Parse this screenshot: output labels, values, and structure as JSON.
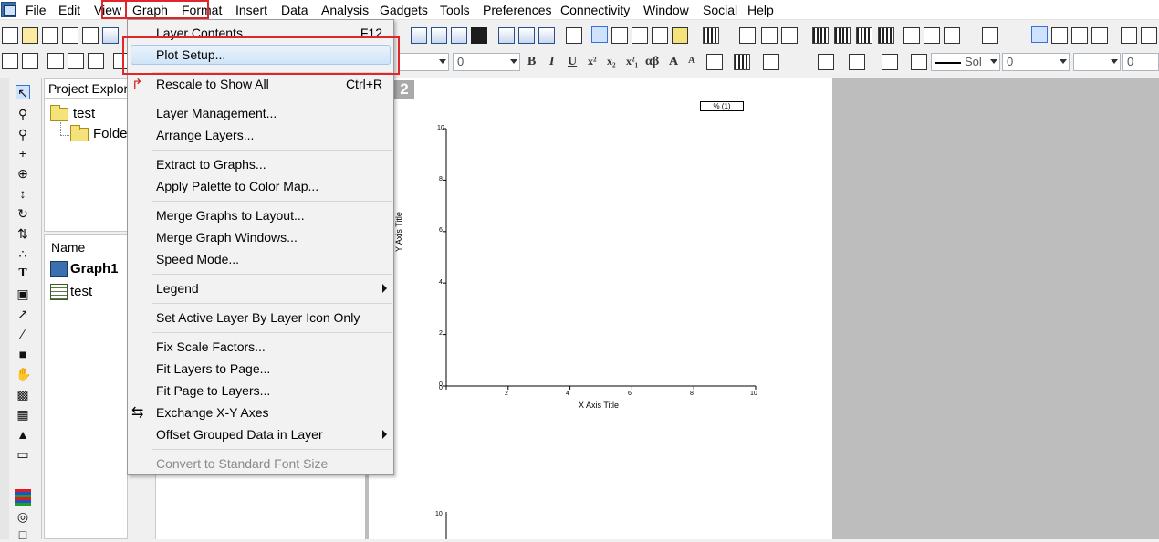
{
  "menubar": {
    "items": [
      "File",
      "Edit",
      "View",
      "Graph",
      "Format",
      "Insert",
      "Data",
      "Analysis",
      "Gadgets",
      "Tools",
      "Preferences",
      "Connectivity",
      "Window",
      "Social",
      "Help"
    ]
  },
  "toolbar": {
    "font_size_value": "0",
    "second_size_value": "0",
    "third_value": "0",
    "line_style_label": "Sol",
    "format_buttons": [
      "B",
      "I",
      "U",
      "x²",
      "x₂",
      "x²₁",
      "αβ",
      "A",
      "A"
    ]
  },
  "project_explorer": {
    "title": "Project Explore",
    "tree": [
      {
        "label": "test"
      },
      {
        "label": "Folde"
      }
    ],
    "list_header": "Name",
    "list_items": [
      {
        "label": "Graph1",
        "bold": true
      },
      {
        "label": "test",
        "bold": false
      }
    ]
  },
  "graph": {
    "layer_tab": "2",
    "legend_text": "% (1)",
    "x_axis_title": "X Axis Title",
    "y_axis_title": "Y Axis Title",
    "x_ticks": [
      "0",
      "2",
      "4",
      "6",
      "8",
      "10"
    ],
    "y_ticks": [
      "0",
      "2",
      "4",
      "6",
      "8",
      "10"
    ],
    "lower_y_tick": "10"
  },
  "graph_menu": {
    "items": [
      {
        "label": "Layer Contents...",
        "shortcut": "F12"
      },
      {
        "label": "Plot Setup...",
        "shortcut": "",
        "highlighted": true
      },
      {
        "label": "Rescale to Show All",
        "shortcut": "Ctrl+R"
      },
      {
        "label": "Layer Management...",
        "shortcut": ""
      },
      {
        "label": "Arrange Layers...",
        "shortcut": ""
      },
      {
        "label": "Extract to Graphs...",
        "shortcut": ""
      },
      {
        "label": "Apply Palette to Color Map...",
        "shortcut": ""
      },
      {
        "label": "Merge Graphs to Layout...",
        "shortcut": ""
      },
      {
        "label": "Merge Graph Windows...",
        "shortcut": ""
      },
      {
        "label": "Speed Mode...",
        "shortcut": ""
      },
      {
        "label": "Legend",
        "shortcut": "",
        "submenu": true
      },
      {
        "label": "Set Active Layer By Layer Icon Only",
        "shortcut": ""
      },
      {
        "label": "Fix Scale Factors...",
        "shortcut": ""
      },
      {
        "label": "Fit Layers to Page...",
        "shortcut": ""
      },
      {
        "label": "Fit Page to Layers...",
        "shortcut": ""
      },
      {
        "label": "Exchange X-Y Axes",
        "shortcut": ""
      },
      {
        "label": "Offset Grouped Data in Layer",
        "shortcut": "",
        "submenu": true
      },
      {
        "label": "Convert to Standard Font Size",
        "shortcut": "",
        "disabled": true
      }
    ]
  },
  "colors": {
    "highlight_border": "#e0252b",
    "menu_hover": "#cfe4f8"
  }
}
